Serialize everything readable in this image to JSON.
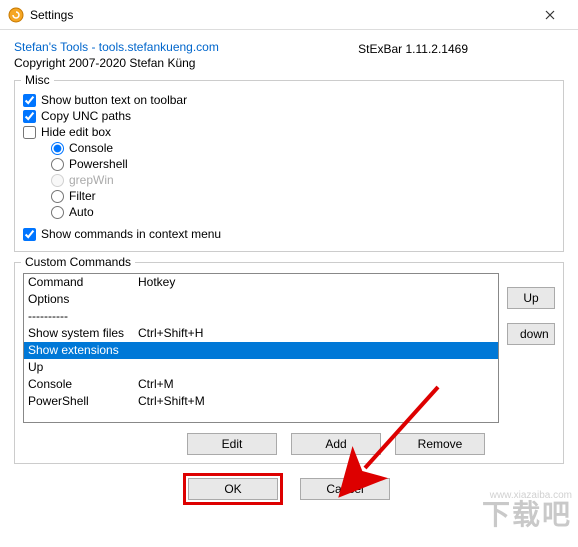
{
  "window": {
    "title": "Settings"
  },
  "header": {
    "link_text": "Stefan's Tools - tools.stefankueng.com",
    "version": "StExBar 1.11.2.1469",
    "copyright": "Copyright 2007-2020 Stefan Küng"
  },
  "misc": {
    "legend": "Misc",
    "show_button_text": "Show button text on toolbar",
    "copy_unc": "Copy UNC paths",
    "hide_edit": "Hide edit box",
    "radios": {
      "console": "Console",
      "powershell": "Powershell",
      "grepwin": "grepWin",
      "filter": "Filter",
      "auto": "Auto"
    },
    "show_commands": "Show commands in context menu"
  },
  "custom": {
    "legend": "Custom Commands",
    "columns": {
      "command": "Command",
      "hotkey": "Hotkey"
    },
    "rows": [
      {
        "c1": "Command",
        "c2": "Hotkey"
      },
      {
        "c1": "Options",
        "c2": ""
      },
      {
        "c1": "----------",
        "c2": ""
      },
      {
        "c1": "Show system files",
        "c2": "Ctrl+Shift+H"
      },
      {
        "c1": "Show extensions",
        "c2": "",
        "selected": true
      },
      {
        "c1": "Up",
        "c2": ""
      },
      {
        "c1": "Console",
        "c2": "Ctrl+M"
      },
      {
        "c1": "PowerShell",
        "c2": "Ctrl+Shift+M"
      }
    ],
    "buttons": {
      "up": "Up",
      "down": "down",
      "edit": "Edit",
      "add": "Add",
      "remove": "Remove"
    }
  },
  "dialog": {
    "ok": "OK",
    "cancel": "Cancel"
  },
  "watermark": {
    "url": "www.xiazaiba.com",
    "text": "下载吧"
  }
}
